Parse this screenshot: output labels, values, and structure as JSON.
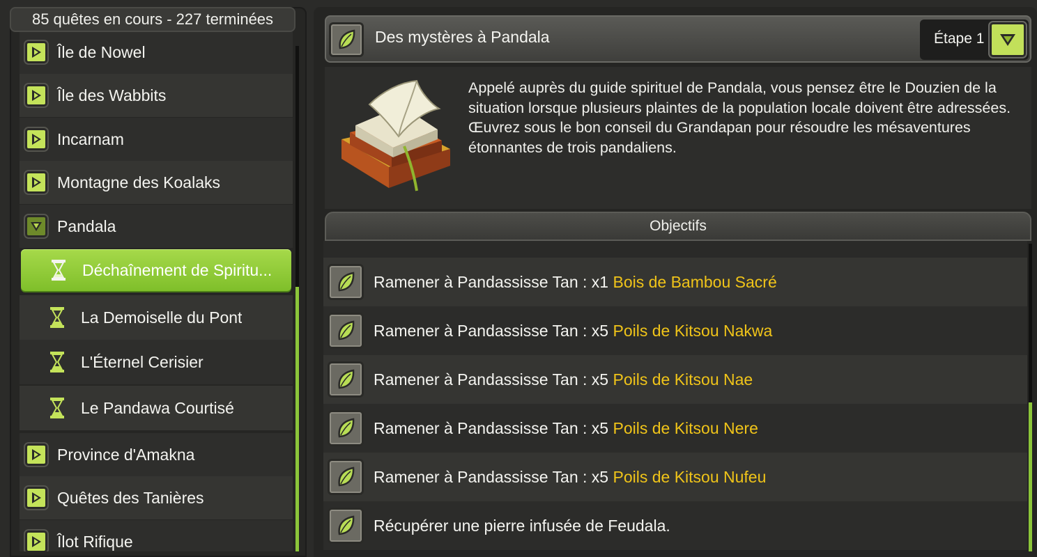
{
  "left": {
    "header": "85 quêtes en cours - 227 terminées",
    "categories": [
      {
        "label": "Île de Nowel"
      },
      {
        "label": "Île des Wabbits"
      },
      {
        "label": "Incarnam"
      },
      {
        "label": "Montagne des Koalaks"
      },
      {
        "label": "Pandala"
      },
      {
        "label": "Province d'Amakna"
      },
      {
        "label": "Quêtes des Tanières"
      },
      {
        "label": "Îlot Rifique"
      }
    ],
    "pandala_quests": [
      {
        "label": "Déchaînement de Spiritu..."
      },
      {
        "label": "La Demoiselle du Pont"
      },
      {
        "label": "L'Éternel Cerisier"
      },
      {
        "label": "Le Pandawa Courtisé"
      }
    ]
  },
  "quest": {
    "title": "Des mystères à Pandala",
    "step": "Étape 1",
    "description": "Appelé auprès du guide spirituel de Pandala, vous pensez être le Douzien de la situation lorsque plusieurs plaintes de la population locale doivent être adressées. Œuvrez sous le bon conseil du Grandapan pour résoudre les mésaventures étonnantes de trois pandaliens."
  },
  "objectives": {
    "header": "Objectifs",
    "items": [
      {
        "text": "Ramener à Pandassisse Tan : x1 ",
        "item": "Bois de Bambou Sacré"
      },
      {
        "text": "Ramener à Pandassisse Tan : x5 ",
        "item": "Poils de Kitsou Nakwa"
      },
      {
        "text": "Ramener à Pandassisse Tan : x5 ",
        "item": "Poils de Kitsou Nae"
      },
      {
        "text": "Ramener à Pandassisse Tan : x5 ",
        "item": "Poils de Kitsou Nere"
      },
      {
        "text": "Ramener à Pandassisse Tan : x5 ",
        "item": "Poils de Kitsou Nufeu"
      },
      {
        "text": "Récupérer une pierre infusée de Feudala.",
        "item": ""
      }
    ]
  },
  "colors": {
    "accent_green": "#a6d94a",
    "item_yellow": "#f0c419"
  },
  "icons": {
    "expand": "play-triangle-icon",
    "collapse": "down-triangle-icon",
    "quest_status": "hourglass-icon",
    "objective": "leaf-icon",
    "quest_image": "open-book-icon"
  }
}
